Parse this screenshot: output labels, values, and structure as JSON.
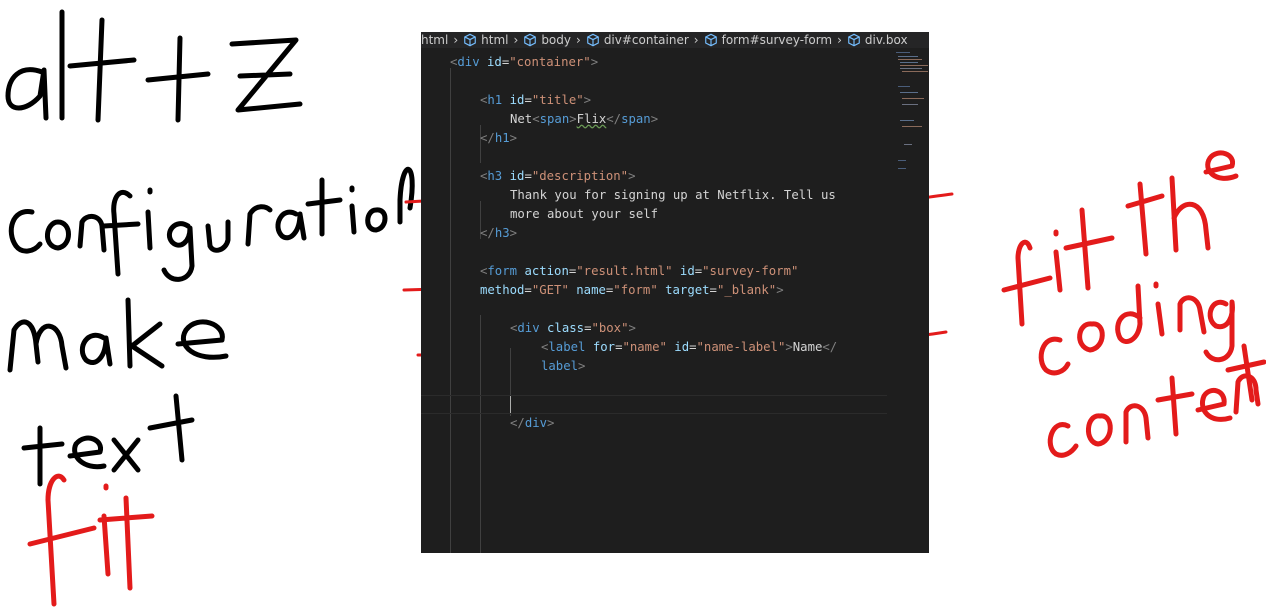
{
  "annotations": {
    "left_notes": [
      "alt + Z",
      "configuration",
      "make",
      "text",
      "fit"
    ],
    "right_note": "fit the coding content"
  },
  "breadcrumb": [
    {
      "label": "html",
      "icon": null
    },
    {
      "label": "html",
      "icon": "element-cube-icon"
    },
    {
      "label": "body",
      "icon": "element-cube-icon"
    },
    {
      "label": "div#container",
      "icon": "element-cube-icon"
    },
    {
      "label": "form#survey-form",
      "icon": "element-cube-icon"
    },
    {
      "label": "div.box",
      "icon": "element-cube-icon"
    }
  ],
  "code": {
    "l1": {
      "open": "<",
      "tag": "div",
      "attr": "id",
      "eq": "=",
      "val": "\"container\"",
      "close": ">"
    },
    "l3": {
      "open": "<",
      "tag": "h1",
      "attr": "id",
      "eq": "=",
      "val": "\"title\"",
      "close": ">"
    },
    "l4": {
      "text": "Net",
      "open": "<",
      "tag": "span",
      "close": ">",
      "inner": "Flix",
      "open2": "</",
      "tag2": "span",
      "close2": ">"
    },
    "l5": {
      "open": "</",
      "tag": "h1",
      "close": ">"
    },
    "l7": {
      "open": "<",
      "tag": "h3",
      "attr": "id",
      "eq": "=",
      "val": "\"description\"",
      "close": ">"
    },
    "l8": {
      "text": "Thank you for signing up at Netflix. Tell us"
    },
    "l9": {
      "text": "more about your self"
    },
    "l10": {
      "open": "</",
      "tag": "h3",
      "close": ">"
    },
    "l12": {
      "open": "<",
      "tag": "form",
      "a1": "action",
      "v1": "\"result.html\"",
      "a2": "id",
      "v2": "\"survey-form\"",
      "eq": "="
    },
    "l13": {
      "a1": "method",
      "v1": "\"GET\"",
      "a2": "name",
      "v2": "\"form\"",
      "a3": "target",
      "v3": "\"_blank\"",
      "eq": "=",
      "close": ">"
    },
    "l15": {
      "open": "<",
      "tag": "div",
      "attr": "class",
      "eq": "=",
      "val": "\"box\"",
      "close": ">"
    },
    "l16": {
      "open": "<",
      "tag": "label",
      "a1": "for",
      "v1": "\"name\"",
      "a2": "id",
      "v2": "\"name-label\"",
      "eq": "=",
      "close": ">",
      "inner": "Name",
      "open2": "</"
    },
    "l17": {
      "tag": "label",
      "close": ">"
    },
    "l19": {
      "open": "</",
      "tag": "div",
      "close": ">"
    }
  },
  "colors": {
    "editor_bg": "#1e1e1e",
    "tag": "#569cd6",
    "attr": "#9cdcfe",
    "string": "#ce9178",
    "annotation_red": "#e31b1b"
  }
}
